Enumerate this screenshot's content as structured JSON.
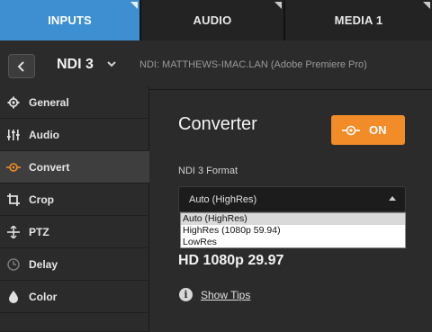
{
  "tabs": [
    {
      "label": "INPUTS",
      "active": true
    },
    {
      "label": "AUDIO",
      "active": false
    },
    {
      "label": "MEDIA 1",
      "active": false
    }
  ],
  "header": {
    "input_name": "NDI 3",
    "source": "NDI: MATTHEWS-IMAC.LAN (Adobe Premiere Pro)"
  },
  "sidebar": {
    "items": [
      {
        "label": "General",
        "icon": "gear-icon"
      },
      {
        "label": "Audio",
        "icon": "sliders-icon"
      },
      {
        "label": "Convert",
        "icon": "convert-icon",
        "active": true
      },
      {
        "label": "Crop",
        "icon": "crop-icon"
      },
      {
        "label": "PTZ",
        "icon": "ptz-icon"
      },
      {
        "label": "Delay",
        "icon": "clock-icon"
      },
      {
        "label": "Color",
        "icon": "droplet-icon"
      }
    ]
  },
  "main": {
    "title": "Converter",
    "toggle_label": "ON",
    "format_label": "NDI 3 Format",
    "format_value": "Auto (HighRes)",
    "options": [
      "Auto (HighRes)",
      "HighRes (1080p 59.94)",
      "LowRes"
    ],
    "resolution": "HD 1080p 29.97",
    "tips_label": "Show Tips"
  },
  "colors": {
    "active_tab": "#3d8fd1",
    "toggle_on": "#f28c28",
    "active_icon": "#f28c28"
  }
}
